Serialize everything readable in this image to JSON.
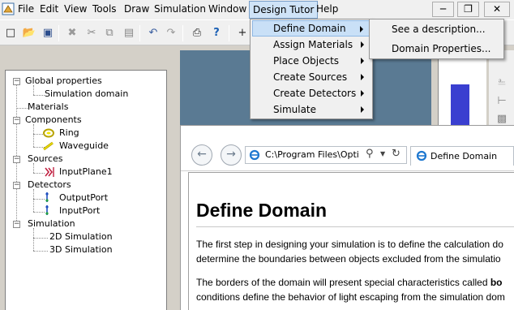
{
  "menubar": {
    "items": [
      "File",
      "Edit",
      "View",
      "Tools",
      "Draw",
      "Simulation",
      "Window",
      "Design Tutor",
      "Help"
    ],
    "window_buttons": [
      "minimize-icon",
      "restore-icon",
      "close-icon"
    ]
  },
  "toolbar": {
    "icons": [
      "new-icon",
      "open-icon",
      "save-icon",
      "cut-disabled-icon",
      "cut-icon",
      "copy-icon",
      "paste-icon",
      "delete-icon",
      "undo-icon",
      "redo-icon",
      "print-icon",
      "help-icon",
      "add-icon"
    ]
  },
  "dropdown": {
    "items": [
      "Define Domain",
      "Assign Materials",
      "Place Objects",
      "Create Sources",
      "Create Detectors",
      "Simulate"
    ],
    "selected": "Define Domain"
  },
  "submenu": {
    "items": [
      "See a description...",
      "Domain Properties..."
    ]
  },
  "tree": {
    "global_properties": "Global properties",
    "simulation_domain": "Simulation domain",
    "materials": "Materials",
    "components": "Components",
    "ring": "Ring",
    "waveguide": "Waveguide",
    "sources": "Sources",
    "input_plane": "InputPlane1",
    "detectors": "Detectors",
    "output_port": "OutputPort",
    "input_port": "InputPort",
    "simulation": "Simulation",
    "sim_2d": "2D Simulation",
    "sim_3d": "3D Simulation"
  },
  "browser": {
    "address": "C:\\Program Files\\Opti",
    "tab_title": "Define Domain",
    "page_title": "Define Domain",
    "para1_line1": "The first step in designing your simulation is to define the calculation do",
    "para1_line2": "determine the boundaries between objects excluded from the simulatio",
    "para2_line1_start": "The borders of the domain will present special characteristics called ",
    "para2_line1_bold": "bo",
    "para2_line2": "conditions define the behavior of light escaping from the simulation dom"
  },
  "colors": {
    "menu_highlight": "#c9e0f7",
    "layout_background": "#5a7a93",
    "layer_bar": "#3a3fd0"
  }
}
